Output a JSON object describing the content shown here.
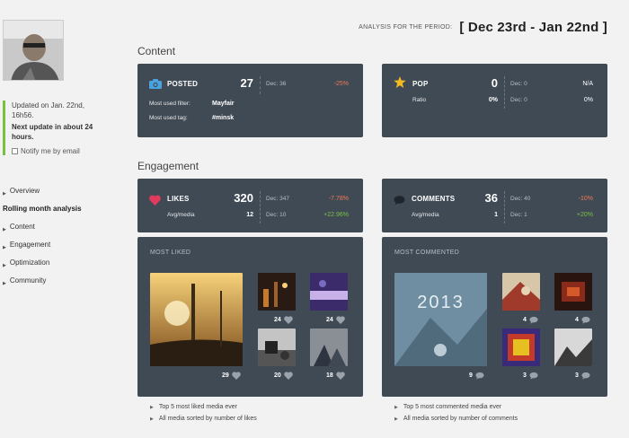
{
  "sidebar": {
    "updated": "Updated on Jan. 22nd, 16h56.",
    "next_update": "Next update in about 24 hours.",
    "notify": "Notify me by email",
    "nav": [
      {
        "label": "Overview"
      },
      {
        "label": "Rolling month analysis"
      },
      {
        "label": "Content"
      },
      {
        "label": "Engagement"
      },
      {
        "label": "Optimization"
      },
      {
        "label": "Community"
      }
    ]
  },
  "header": {
    "period_label": "ANALYSIS FOR THE PERIOD:",
    "period_value": "[ Dec 23rd - Jan 22nd ]"
  },
  "content": {
    "title": "Content",
    "posted": {
      "title": "POSTED",
      "value": "27",
      "dec_label": "Dec: 36",
      "change": "-25%",
      "filter_label": "Most used filter:",
      "filter_value": "Mayfair",
      "tag_label": "Most used tag:",
      "tag_value": "#minsk"
    },
    "pop": {
      "title": "POP",
      "value": "0",
      "dec_label": "Dec: 0",
      "change": "N/A",
      "ratio_label": "Ratio",
      "ratio_value": "0%",
      "ratio_dec": "Dec: 0",
      "ratio_change": "0%"
    }
  },
  "engagement": {
    "title": "Engagement",
    "likes": {
      "title": "LIKES",
      "value": "320",
      "dec_label": "Dec: 347",
      "change": "-7.78%",
      "avg_label": "Avg/media",
      "avg_value": "12",
      "avg_dec": "Dec: 10",
      "avg_change": "+22.96%"
    },
    "comments": {
      "title": "COMMENTS",
      "value": "36",
      "dec_label": "Dec: 40",
      "change": "-10%",
      "avg_label": "Avg/media",
      "avg_value": "1",
      "avg_dec": "Dec: 1",
      "avg_change": "+20%"
    },
    "most_liked": {
      "title": "MOST LIKED",
      "counts": [
        "29",
        "24",
        "24",
        "20",
        "18"
      ],
      "bullets": [
        "Top 5 most liked media ever",
        "All media sorted by number of likes"
      ]
    },
    "most_commented": {
      "title": "MOST COMMENTED",
      "poster_text": "2013",
      "counts": [
        "9",
        "4",
        "4",
        "3",
        "3"
      ],
      "bullets": [
        "Top 5 most commented media ever",
        "All media sorted by number of comments"
      ]
    }
  },
  "colors": {
    "card_bg": "#3f4a55",
    "negative": "#f07a52",
    "positive": "#7ac143",
    "accent_bar": "#7ac143"
  }
}
